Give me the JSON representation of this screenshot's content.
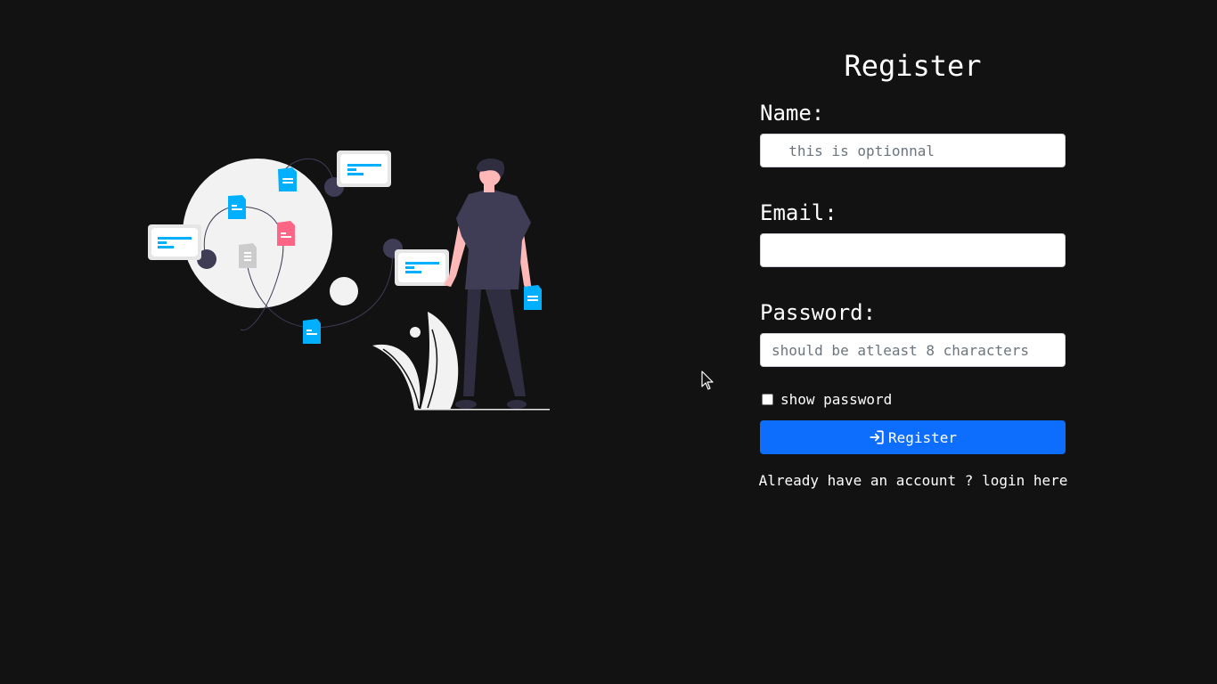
{
  "form": {
    "title": "Register",
    "name_label": "Name:",
    "name_placeholder": "  this is optionnal",
    "name_value": "",
    "email_label": "Email:",
    "email_placeholder": "",
    "email_value": "",
    "password_label": "Password:",
    "password_placeholder": "should be atleast 8 characters",
    "password_value": "",
    "show_password_label": "show password",
    "show_password_checked": false,
    "register_button_label": "Register",
    "login_prompt": "Already have an account ? ",
    "login_link": "login here"
  },
  "colors": {
    "background": "#121212",
    "primary": "#0d6efd",
    "accent_blue": "#00b0ff",
    "accent_pink": "#ff6584",
    "figure_dark": "#3f3d56"
  },
  "icons": {
    "register_icon": "login-arrow-icon",
    "cursor": "mouse-pointer-icon"
  }
}
